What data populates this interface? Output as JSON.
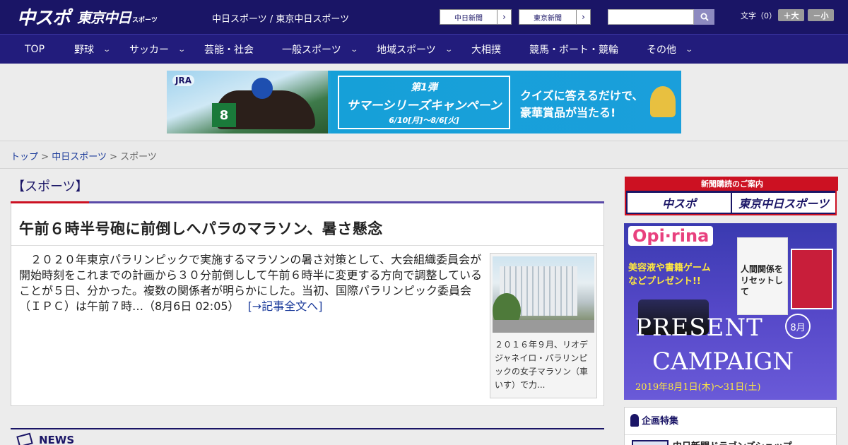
{
  "header": {
    "logo_main": "中スポ",
    "logo_sub": "東京中日",
    "logo_sub_small": "スポーツ",
    "site_link": "中日スポーツ / 東京中日スポーツ",
    "ext_links": [
      {
        "label": "中日新聞",
        "arrow": "›"
      },
      {
        "label": "東京新聞",
        "arrow": "›"
      }
    ],
    "search": {
      "placeholder": "",
      "icon": "search-icon"
    },
    "font_size_label": "文字（0）",
    "font_bigger": "＋大",
    "font_smaller": "－小"
  },
  "nav": {
    "items": [
      {
        "label": "TOP",
        "has_dropdown": false
      },
      {
        "label": "野球",
        "has_dropdown": true
      },
      {
        "label": "サッカー",
        "has_dropdown": true
      },
      {
        "label": "芸能・社会",
        "has_dropdown": false
      },
      {
        "label": "一般スポーツ",
        "has_dropdown": true
      },
      {
        "label": "地域スポーツ",
        "has_dropdown": true
      },
      {
        "label": "大相撲",
        "has_dropdown": false
      },
      {
        "label": "競馬・ボート・競輪",
        "has_dropdown": false
      },
      {
        "label": "その他",
        "has_dropdown": true
      }
    ],
    "chevron": "⌄"
  },
  "banner": {
    "jra": "JRA",
    "number": "8",
    "line1": "第1弾",
    "line2": "サマーシリーズキャンペーン",
    "line3": "6/10[月]～8/6[火]",
    "right1": "クイズに答えるだけで、",
    "right2": "豪華賞品が当たる!"
  },
  "breadcrumb": {
    "items": [
      "トップ",
      "中日スポーツ"
    ],
    "current": "スポーツ",
    "separator": ">"
  },
  "main": {
    "category": "【スポーツ】",
    "headline": "午前６時半号砲に前倒しへパラのマラソン、暑さ懸念",
    "body": "　２０２０年東京パラリンピックで実施するマラソンの暑さ対策として、大会組織委員会が開始時刻をこれまでの計画から３０分前倒しして午前６時半に変更する方向で調整していることが５日、分かった。複数の関係者が明らかにした。当初、国際パラリンピック委員会（ＩＰＣ）は午前７時…（8月6日 02:05）",
    "read_more": "[→記事全文へ]",
    "photo_caption": "２０１６年９月、リオデジャネイロ・パラリンピックの女子マラソン（車いす）で力...",
    "news_label": "NEWS"
  },
  "sidebar": {
    "subscribe_head": "新聞購読のご案内",
    "subscribe_logos": [
      "中スポ",
      "東京中日スポーツ"
    ],
    "ad": {
      "brand": "Opi·rina",
      "promo": "美容液や書籍ゲームなどプレゼント!!",
      "book_text": "人間関係をリセットして",
      "present": "PRESENT",
      "campaign": "CAMPAIGN",
      "month": "8月",
      "dates": "2019年8月1日(木)～31日(土)"
    },
    "feature_head": "企画特集",
    "feature_item": "中日新聞ドラゴンズショップ"
  },
  "colors": {
    "header_bg": "#1a1566",
    "nav_bg": "#221c7c",
    "accent_red": "#cc1122",
    "link": "#1a3a9a"
  }
}
